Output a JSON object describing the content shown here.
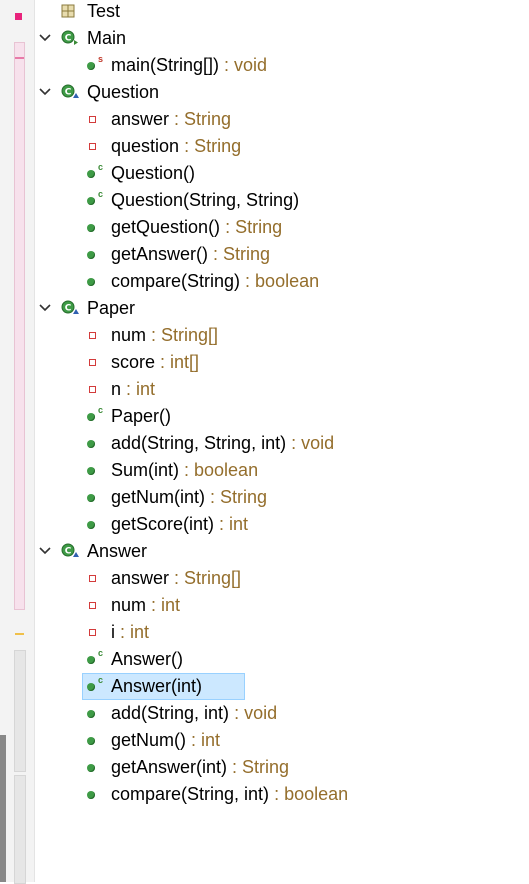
{
  "outline": {
    "items": [
      {
        "kind": "package",
        "label": "Test",
        "type": "",
        "level": 0
      },
      {
        "kind": "class-main",
        "label": "Main",
        "type": "",
        "level": 0,
        "expanded": true
      },
      {
        "kind": "method-static",
        "label": "main(String[])",
        "type": " : void",
        "level": 1
      },
      {
        "kind": "class",
        "label": "Question",
        "type": "",
        "level": 0,
        "expanded": true
      },
      {
        "kind": "field",
        "label": "answer",
        "type": " : String",
        "level": 1
      },
      {
        "kind": "field",
        "label": "question",
        "type": " : String",
        "level": 1
      },
      {
        "kind": "constructor",
        "label": "Question()",
        "type": "",
        "level": 1
      },
      {
        "kind": "constructor",
        "label": "Question(String, String)",
        "type": "",
        "level": 1
      },
      {
        "kind": "method",
        "label": "getQuestion()",
        "type": " : String",
        "level": 1
      },
      {
        "kind": "method",
        "label": "getAnswer()",
        "type": " : String",
        "level": 1
      },
      {
        "kind": "method",
        "label": "compare(String)",
        "type": " : boolean",
        "level": 1
      },
      {
        "kind": "class",
        "label": "Paper",
        "type": "",
        "level": 0,
        "expanded": true
      },
      {
        "kind": "field",
        "label": "num",
        "type": " : String[]",
        "level": 1
      },
      {
        "kind": "field",
        "label": "score",
        "type": " : int[]",
        "level": 1
      },
      {
        "kind": "field",
        "label": "n",
        "type": " : int",
        "level": 1
      },
      {
        "kind": "constructor",
        "label": "Paper()",
        "type": "",
        "level": 1
      },
      {
        "kind": "method",
        "label": "add(String, String, int)",
        "type": " : void",
        "level": 1
      },
      {
        "kind": "method",
        "label": "Sum(int)",
        "type": " : boolean",
        "level": 1
      },
      {
        "kind": "method",
        "label": "getNum(int)",
        "type": " : String",
        "level": 1
      },
      {
        "kind": "method",
        "label": "getScore(int)",
        "type": " : int",
        "level": 1
      },
      {
        "kind": "class",
        "label": "Answer",
        "type": "",
        "level": 0,
        "expanded": true
      },
      {
        "kind": "field",
        "label": "answer",
        "type": " : String[]",
        "level": 1
      },
      {
        "kind": "field",
        "label": "num",
        "type": " : int",
        "level": 1
      },
      {
        "kind": "field",
        "label": "i",
        "type": " : int",
        "level": 1
      },
      {
        "kind": "constructor",
        "label": "Answer()",
        "type": "",
        "level": 1
      },
      {
        "kind": "constructor",
        "label": "Answer(int)",
        "type": "",
        "level": 1,
        "selected": true
      },
      {
        "kind": "method",
        "label": "add(String, int)",
        "type": " : void",
        "level": 1
      },
      {
        "kind": "method",
        "label": "getNum()",
        "type": " : int",
        "level": 1
      },
      {
        "kind": "method",
        "label": "getAnswer(int)",
        "type": " : String",
        "level": 1
      },
      {
        "kind": "method",
        "label": "compare(String, int)",
        "type": " : boolean",
        "level": 1
      }
    ]
  },
  "icons": {
    "package": "package-icon",
    "class": "class-icon",
    "class-main": "main-class-icon",
    "field": "private-field-icon",
    "method": "public-method-icon",
    "method-static": "static-method-icon",
    "constructor": "constructor-icon",
    "expand": "chevron-down-icon"
  },
  "colors": {
    "type_text": "#946e2c",
    "method_green": "#3e9b46",
    "field_red": "#d33b3b",
    "selection_bg": "#cce8ff",
    "error_marker": "#e8237c"
  }
}
